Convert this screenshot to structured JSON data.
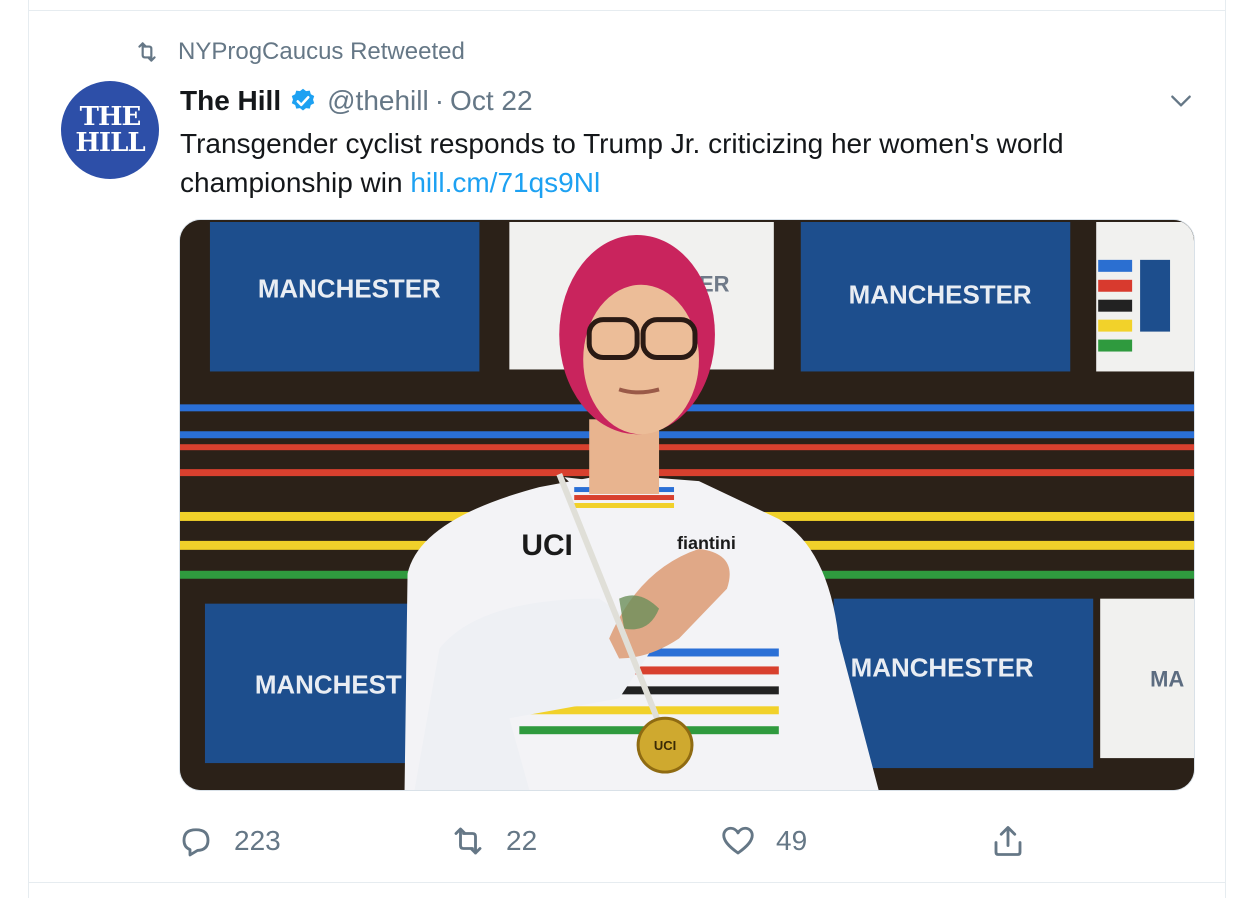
{
  "retweet_context": {
    "text": "NYProgCaucus Retweeted"
  },
  "avatar": {
    "line1": "THE",
    "line2": "HILL"
  },
  "tweet": {
    "name": "The Hill",
    "handle": "@thehill",
    "separator": "·",
    "date": "Oct 22",
    "text": "Transgender cyclist responds to Trump Jr. criticizing her women's world championship win ",
    "link": "hill.cm/71qs9Nl"
  },
  "media_text": {
    "banner1": "MANCHESTER",
    "banner2": "ER",
    "banner3": "MANCHESTER",
    "banner4": "MANCHEST",
    "banner5": "MANCHESTER",
    "banner6": "MA",
    "jersey_brand": "UCI",
    "jersey_sponsor": "fiantini",
    "medal": "UCI"
  },
  "actions": {
    "replies": "223",
    "retweets": "22",
    "likes": "49"
  },
  "colors": {
    "link": "#1da1f2",
    "muted": "#657786",
    "verified": "#1da1f2",
    "avatar_bg": "#2d4fa8"
  }
}
